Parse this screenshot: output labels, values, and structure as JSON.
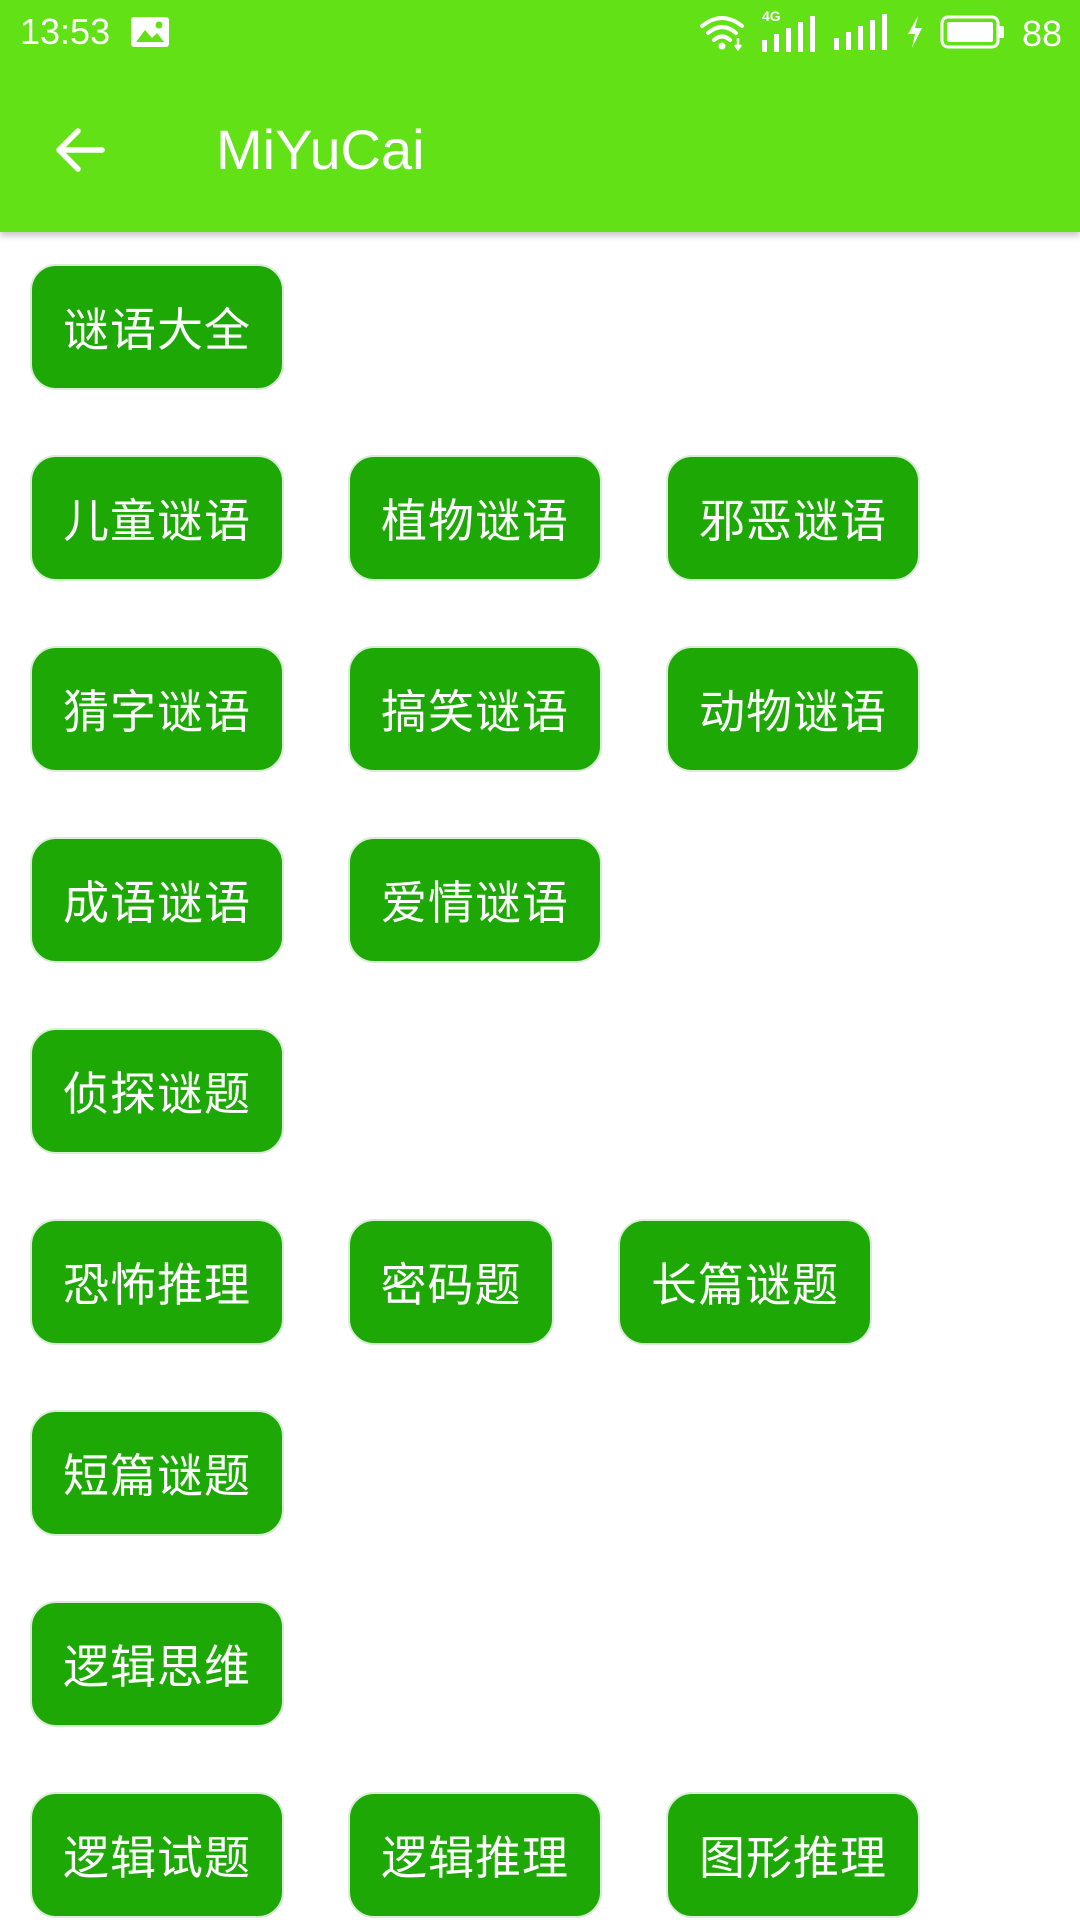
{
  "status_bar": {
    "time": "13:53",
    "network_label": "4G",
    "battery_level": "88",
    "icons": [
      "image-icon",
      "wifi-icon",
      "signal-4g-icon",
      "signal-icon",
      "charging-icon",
      "battery-icon"
    ]
  },
  "app_bar": {
    "title": "MiYuCai",
    "back_icon": "arrow-left-icon"
  },
  "colors": {
    "app_bar": "#63e117",
    "chip_background": "#1ea805",
    "chip_text": "#ffffff"
  },
  "categories": [
    [
      "谜语大全"
    ],
    [
      "儿童谜语",
      "植物谜语",
      "邪恶谜语"
    ],
    [
      "猜字谜语",
      "搞笑谜语",
      "动物谜语"
    ],
    [
      "成语谜语",
      "爱情谜语"
    ],
    [
      "侦探谜题"
    ],
    [
      "恐怖推理",
      "密码题",
      "长篇谜题"
    ],
    [
      "短篇谜题"
    ],
    [
      "逻辑思维"
    ],
    [
      "逻辑试题",
      "逻辑推理",
      "图形推理"
    ]
  ]
}
